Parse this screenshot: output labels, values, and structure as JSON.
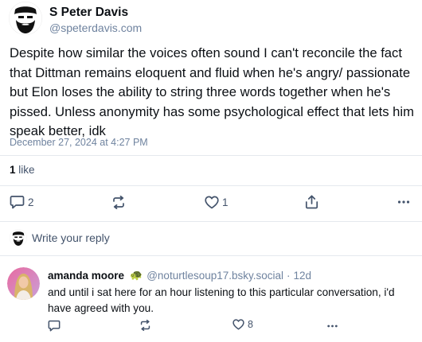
{
  "post": {
    "author_name": "S Peter Davis",
    "author_handle": "@speterdavis.com",
    "text": "Despite how similar the voices often sound I can't reconcile the fact that Dittman remains eloquent and fluid when he's angry/ passionate but Elon loses the ability to string three words together when he's pissed. Unless anonymity has some psychological effect that lets him speak better, idk",
    "timestamp": "December 27, 2024 at 4:27 PM",
    "like_count": "1",
    "like_label": "like",
    "actions": {
      "reply_count": "2",
      "repost_count": "",
      "like_count": "1"
    },
    "avatar_icon": "bearded-face-logo-icon"
  },
  "reply_bar": {
    "placeholder": "Write your reply"
  },
  "comment": {
    "author_name": "amanda moore",
    "badge_emoji": "🐢",
    "author_handle": "@noturtlesoup17.bsky.social",
    "separator": "·",
    "time": "12d",
    "text": "and until i sat here for an hour listening to this particular conversation, i'd have agreed with you.",
    "actions": {
      "reply_count": "",
      "repost_count": "",
      "like_count": "8"
    }
  },
  "colors": {
    "text": "#0b0f14",
    "muted": "#6f839f",
    "icon": "#43536b",
    "divider": "#e5e9ee"
  }
}
